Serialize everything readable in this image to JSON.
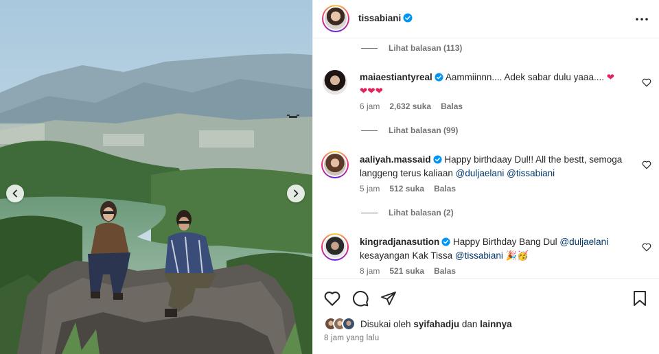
{
  "post": {
    "author": "tissabiani",
    "author_verified": true,
    "more_icon": "more-horizontal-icon"
  },
  "photo": {
    "alt_icons": {
      "prev": "chevron-left-icon",
      "next": "chevron-right-icon"
    }
  },
  "comments": [
    {
      "type": "replies",
      "label": "Lihat balasan (113)"
    },
    {
      "type": "comment",
      "username": "maiaestiantyreal",
      "verified": true,
      "text": "Aammiinnn.... Adek sabar dulu yaaa....",
      "emoji": "❤\n❤❤❤",
      "time": "6 jam",
      "likes": "2,632 suka",
      "reply": "Balas"
    },
    {
      "type": "replies",
      "label": "Lihat balasan (99)"
    },
    {
      "type": "comment",
      "username": "aaliyah.massaid",
      "verified": true,
      "text": "Happy birthdaay Dul!! All the bestt, semoga langgeng terus kaliaan",
      "mentions": [
        "@duljaelani",
        "@tissabiani"
      ],
      "time": "5 jam",
      "likes": "512 suka",
      "reply": "Balas"
    },
    {
      "type": "replies",
      "label": "Lihat balasan (2)"
    },
    {
      "type": "comment",
      "username": "kingradjanasution",
      "verified": true,
      "text": "Happy Birthday Bang Dul",
      "mention1": "@duljaelani",
      "text2": "kesayangan Kak Tissa",
      "mention2": "@tissabiani",
      "emoji": "🎉🥳",
      "time": "8 jam",
      "likes": "521 suka",
      "reply": "Balas"
    }
  ],
  "footer": {
    "liked_prefix": "Disukai oleh",
    "liked_user": "syifahadju",
    "liked_and": "dan",
    "liked_others": "lainnya",
    "time_ago": "8 jam yang lalu"
  },
  "colors": {
    "text": "#262626",
    "secondary": "#737373",
    "mention": "#00376b",
    "verified": "#0095f6",
    "heart": "#ff3040"
  }
}
